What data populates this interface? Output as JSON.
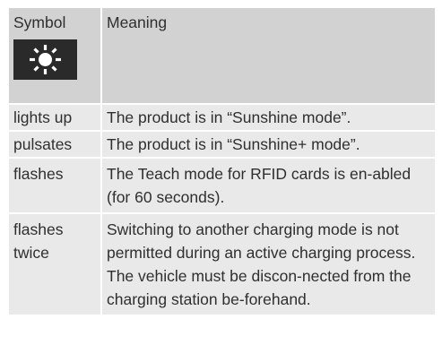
{
  "table": {
    "headers": {
      "symbol": "Symbol",
      "meaning": "Meaning"
    },
    "symbol_icon": "sun-icon",
    "colors": {
      "header_bg": "#d2d2d2",
      "row_bg": "#e9e9e9",
      "icon_bg": "#2a2a2a",
      "icon_fg": "#ffffff",
      "text": "#2f2f2f"
    },
    "rows": [
      {
        "symbol": "lights up",
        "meaning": "The product is in “Sunshine mode”."
      },
      {
        "symbol": "pulsates",
        "meaning": "The product is in “Sunshine+ mode”."
      },
      {
        "symbol": "flashes",
        "meaning": "The Teach mode for RFID cards is en-abled (for 60 seconds)."
      },
      {
        "symbol": "flashes twice",
        "meaning": "Switching to another charging mode is not permitted during an active charging process. The vehicle must be discon-nected from the charging station be-forehand."
      }
    ]
  }
}
